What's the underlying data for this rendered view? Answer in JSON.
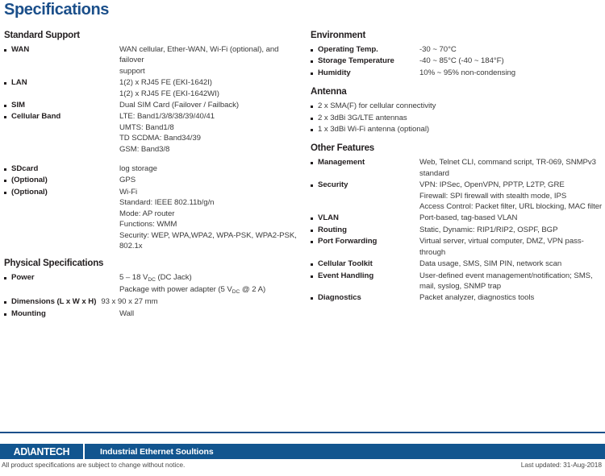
{
  "title": "Specifications",
  "colors": {
    "title_blue": "#1b4f8a",
    "footer_blue": "#12558f",
    "text": "#231f20"
  },
  "left_column": [
    {
      "heading": "Standard Support",
      "items": [
        {
          "label": "WAN",
          "values": [
            "WAN cellular, Ether-WAN, Wi-Fi (optional), and failover",
            "support"
          ]
        },
        {
          "label": "LAN",
          "values": [
            "1(2) x RJ45 FE (EKI-1642I)",
            "1(2) x RJ45 FE (EKI-1642WI)"
          ]
        },
        {
          "label": "SIM",
          "values": [
            "Dual SIM Card (Failover / Failback)"
          ]
        },
        {
          "label": "Cellular Band",
          "values": [
            "LTE: Band1/3/8/38/39/40/41",
            "UMTS: Band1/8",
            "TD SCDMA: Band34/39",
            "GSM: Band3/8"
          ]
        }
      ]
    },
    {
      "heading": "",
      "items": [
        {
          "label": "SDcard",
          "values": [
            "log storage"
          ]
        },
        {
          "label": "(Optional)",
          "values": [
            "GPS"
          ]
        },
        {
          "label": "(Optional)",
          "values": [
            "Wi-Fi",
            "Standard: IEEE 802.11b/g/n",
            "Mode: AP router",
            "Functions: WMM",
            "Security: WEP, WPA,WPA2, WPA-PSK, WPA2-PSK,",
            "802.1x"
          ]
        }
      ]
    },
    {
      "heading": "Physical Specifications",
      "items": [
        {
          "label": "Power",
          "values": [
            "5 – 18 V<sub>DC</sub> (DC Jack)",
            "Package with power adapter (5 V<sub>DC</sub> @ 2 A)"
          ],
          "html": true
        },
        {
          "label": "Dimensions (L x W x H)",
          "values": [
            "93 x 90 x 27 mm"
          ],
          "wide": true
        },
        {
          "label": "Mounting",
          "values": [
            "Wall"
          ]
        }
      ]
    }
  ],
  "right_column": [
    {
      "heading": "Environment",
      "items": [
        {
          "label": "Operating Temp.",
          "values": [
            "-30 ~ 70°C"
          ]
        },
        {
          "label": "Storage Temperature",
          "values": [
            "-40 ~ 85°C (-40 ~ 184°F)"
          ]
        },
        {
          "label": "Humidity",
          "values": [
            "10% ~ 95% non-condensing"
          ]
        }
      ]
    },
    {
      "heading": "Antenna",
      "plain": true,
      "items": [
        {
          "label": "2 x SMA(F) for cellular connectivity"
        },
        {
          "label": "2 x 3dBi 3G/LTE antennas"
        },
        {
          "label": "1 x 3dBi Wi-Fi antenna (optional)"
        }
      ]
    },
    {
      "heading": "Other Features",
      "items": [
        {
          "label": "Management",
          "values": [
            "Web, Telnet CLI, command script, TR-069, SNMPv3",
            "standard"
          ]
        },
        {
          "label": "Security",
          "values": [
            "VPN: IPSec, OpenVPN, PPTP, L2TP, GRE",
            "Firewall: SPI firewall with stealth mode, IPS",
            "Access Control: Packet filter, URL blocking, MAC filter"
          ]
        },
        {
          "label": "VLAN",
          "values": [
            "Port-based, tag-based VLAN"
          ]
        },
        {
          "label": "Routing",
          "values": [
            "Static, Dynamic: RIP1/RIP2, OSPF, BGP"
          ]
        },
        {
          "label": "Port Forwarding",
          "values": [
            "Virtual server, virtual computer, DMZ, VPN pass-",
            "through"
          ]
        },
        {
          "label": "Cellular Toolkit",
          "values": [
            "Data usage, SMS, SIM PIN, network scan"
          ]
        },
        {
          "label": "Event Handling",
          "values": [
            "User-defined event management/notification; SMS,",
            "mail, syslog, SNMP trap"
          ]
        },
        {
          "label": "Diagnostics",
          "values": [
            "Packet analyzer, diagnostics tools"
          ]
        }
      ]
    }
  ],
  "footer": {
    "logo": "AD\\ANTECH",
    "tagline": "Industrial Ethernet Soultions",
    "note": "All product specifications are subject to change without notice.",
    "updated": "Last updated: 31-Aug-2018"
  }
}
